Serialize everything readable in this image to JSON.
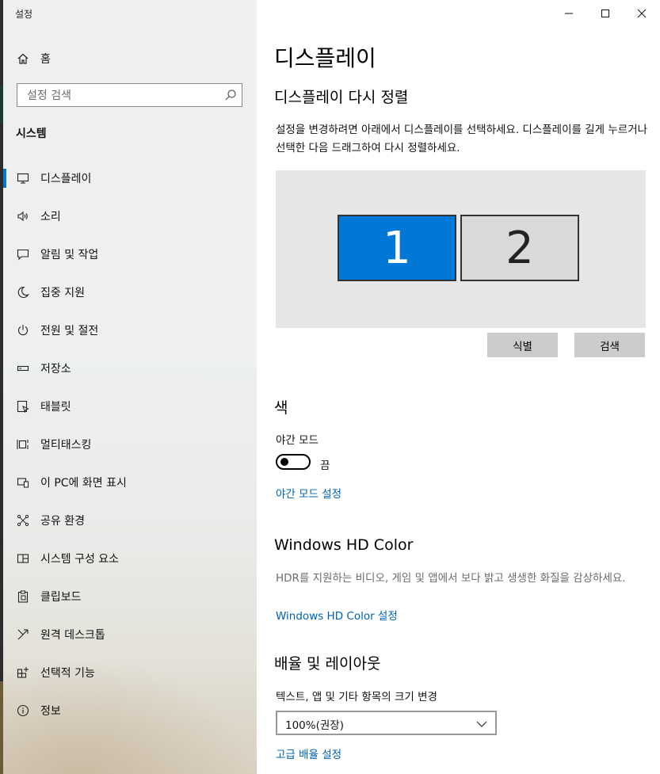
{
  "window": {
    "app_title": "설정"
  },
  "sidebar": {
    "home_label": "홈",
    "search_placeholder": "설정 검색",
    "section_title": "시스템",
    "items": [
      {
        "label": "디스플레이",
        "icon": "monitor-icon",
        "active": true
      },
      {
        "label": "소리",
        "icon": "speaker-icon"
      },
      {
        "label": "알림 및 작업",
        "icon": "message-icon"
      },
      {
        "label": "집중 지원",
        "icon": "moon-icon"
      },
      {
        "label": "전원 및 절전",
        "icon": "power-icon"
      },
      {
        "label": "저장소",
        "icon": "storage-icon"
      },
      {
        "label": "태블릿",
        "icon": "tablet-icon"
      },
      {
        "label": "멀티태스킹",
        "icon": "multitasking-icon"
      },
      {
        "label": "이 PC에 화면 표시",
        "icon": "project-icon"
      },
      {
        "label": "공유 환경",
        "icon": "share-icon"
      },
      {
        "label": "시스템 구성 요소",
        "icon": "components-icon"
      },
      {
        "label": "클립보드",
        "icon": "clipboard-icon"
      },
      {
        "label": "원격 데스크톱",
        "icon": "remote-desktop-icon"
      },
      {
        "label": "선택적 기능",
        "icon": "optional-features-icon"
      },
      {
        "label": "정보",
        "icon": "info-icon"
      }
    ]
  },
  "main": {
    "title": "디스플레이",
    "arrange": {
      "heading": "디스플레이 다시 정렬",
      "description": "설정을 변경하려면 아래에서 디스플레이를 선택하세요. 디스플레이를 길게 누르거나 선택한 다음 드래그하여 다시 정렬하세요.",
      "monitor_1": "1",
      "monitor_2": "2",
      "identify_button": "식별",
      "detect_button": "검색"
    },
    "color": {
      "heading": "색",
      "night_light_label": "야간 모드",
      "toggle_state": "끔",
      "night_light_settings_link": "야간 모드 설정"
    },
    "hdr": {
      "heading": "Windows HD Color",
      "description": "HDR를 지원하는 비디오, 게임 및 앱에서 보다 밝고 생생한 화질을 감상하세요.",
      "link": "Windows HD Color 설정"
    },
    "scale": {
      "heading": "배율 및 레이아웃",
      "label": "텍스트, 앱 및 기타 항목의 크기 변경",
      "selected": "100%(권장)",
      "advanced_link": "고급 배율 설정"
    }
  },
  "colors": {
    "accent": "#0078d7",
    "link": "#0063b1"
  }
}
